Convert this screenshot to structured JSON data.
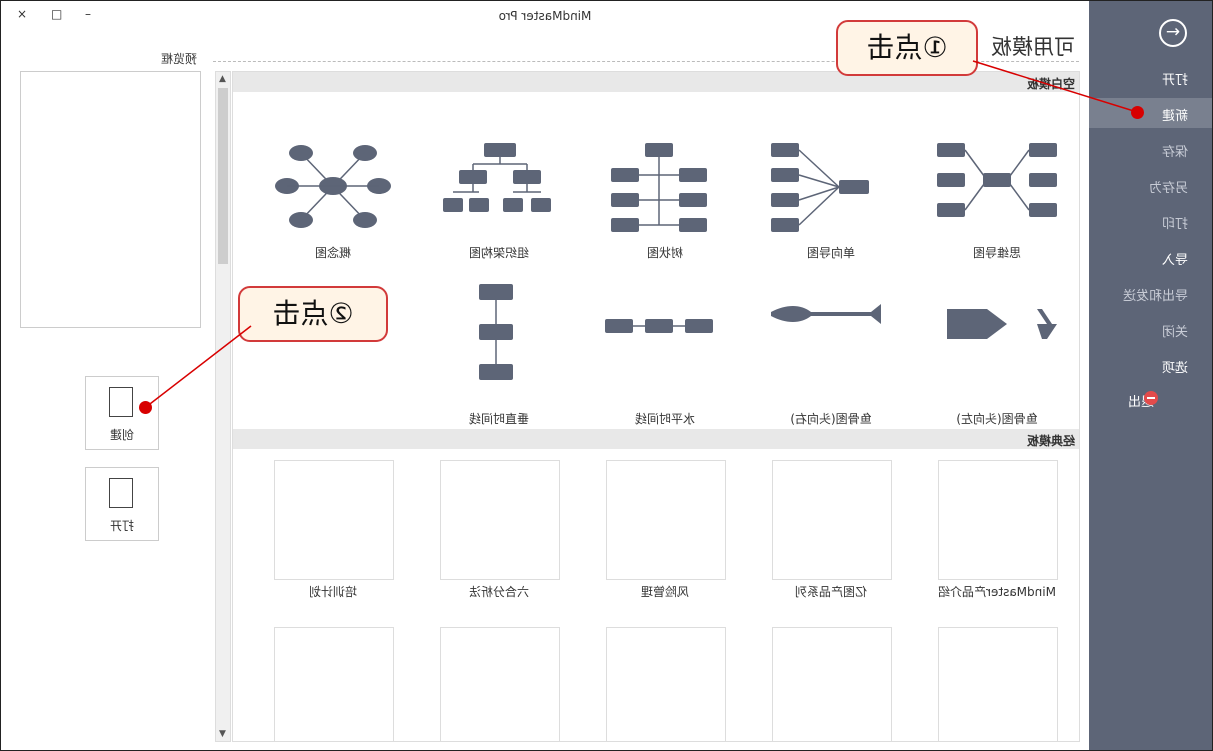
{
  "window": {
    "title": "MindMaster Pro",
    "controls": [
      "×",
      "□",
      "–"
    ]
  },
  "sidebar": {
    "arrow_glyph": "→",
    "items": [
      {
        "label": "打开",
        "dim": false
      },
      {
        "label": "新建",
        "dim": false,
        "active": true
      },
      {
        "label": "保存",
        "dim": true
      },
      {
        "label": "另存为",
        "dim": true
      },
      {
        "label": "打印",
        "dim": true
      },
      {
        "label": "导入",
        "dim": false
      },
      {
        "label": "导出和发送",
        "dim": true
      },
      {
        "label": "关闭",
        "dim": true
      },
      {
        "label": "选项",
        "dim": false
      },
      {
        "label": "退出",
        "dim": false
      }
    ]
  },
  "main": {
    "heading": "可用模板",
    "preview_label": "预览框",
    "buttons": {
      "create": "创建",
      "open": "打开"
    },
    "sections": {
      "blank": "空白模板",
      "classic": "经典模板"
    },
    "blank_templates": [
      {
        "label": "思维导图",
        "icon": "mindmap-icon"
      },
      {
        "label": "单向导图",
        "icon": "oneway-map-icon"
      },
      {
        "label": "树状图",
        "icon": "tree-chart-icon"
      },
      {
        "label": "组织架构图",
        "icon": "org-chart-icon"
      },
      {
        "label": "概念图",
        "icon": "concept-map-icon"
      },
      {
        "label": "鱼骨图(头向左)",
        "icon": "fishbone-left-icon"
      },
      {
        "label": "鱼骨图(头向右)",
        "icon": "fishbone-right-icon"
      },
      {
        "label": "水平时间线",
        "icon": "horizontal-timeline-icon"
      },
      {
        "label": "垂直时间线",
        "icon": "vertical-timeline-icon"
      }
    ],
    "classic_templates": [
      {
        "label": "MindMaster产品介绍"
      },
      {
        "label": "亿图产品系列"
      },
      {
        "label": "风险管理"
      },
      {
        "label": "六合分析法"
      },
      {
        "label": "培训计划"
      },
      {
        "label": ""
      },
      {
        "label": ""
      },
      {
        "label": ""
      },
      {
        "label": ""
      },
      {
        "label": ""
      }
    ]
  },
  "annotations": {
    "callout1": "①点击",
    "callout2": "②点击"
  },
  "colors": {
    "sidebar_bg": "#5d6577",
    "node": "#5d6577",
    "annotation": "#d80000"
  }
}
